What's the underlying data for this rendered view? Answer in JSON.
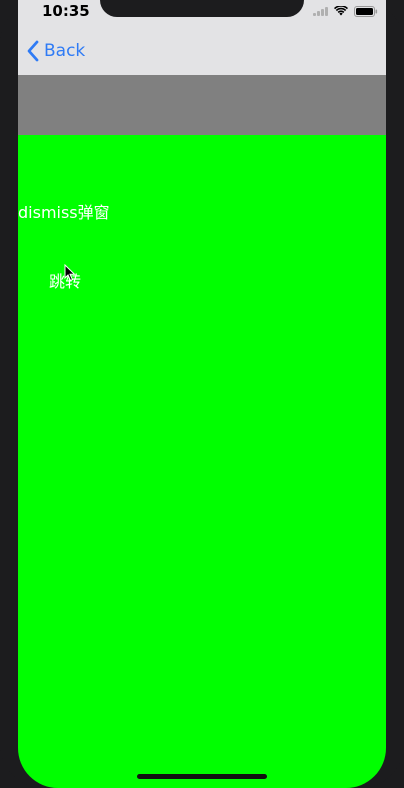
{
  "status_bar": {
    "time": "10:35",
    "icons": [
      "signal-icon",
      "wifi-icon",
      "battery-icon"
    ]
  },
  "nav": {
    "back_label": "Back"
  },
  "content": {
    "dismiss_label": "dismiss弹窗",
    "jump_label": "跳转"
  },
  "colors": {
    "background": "#00ff00",
    "nav_bar": "#e3e3e5",
    "banner": "#808080",
    "accent": "#2f7bf5",
    "text": "#ffffff"
  }
}
